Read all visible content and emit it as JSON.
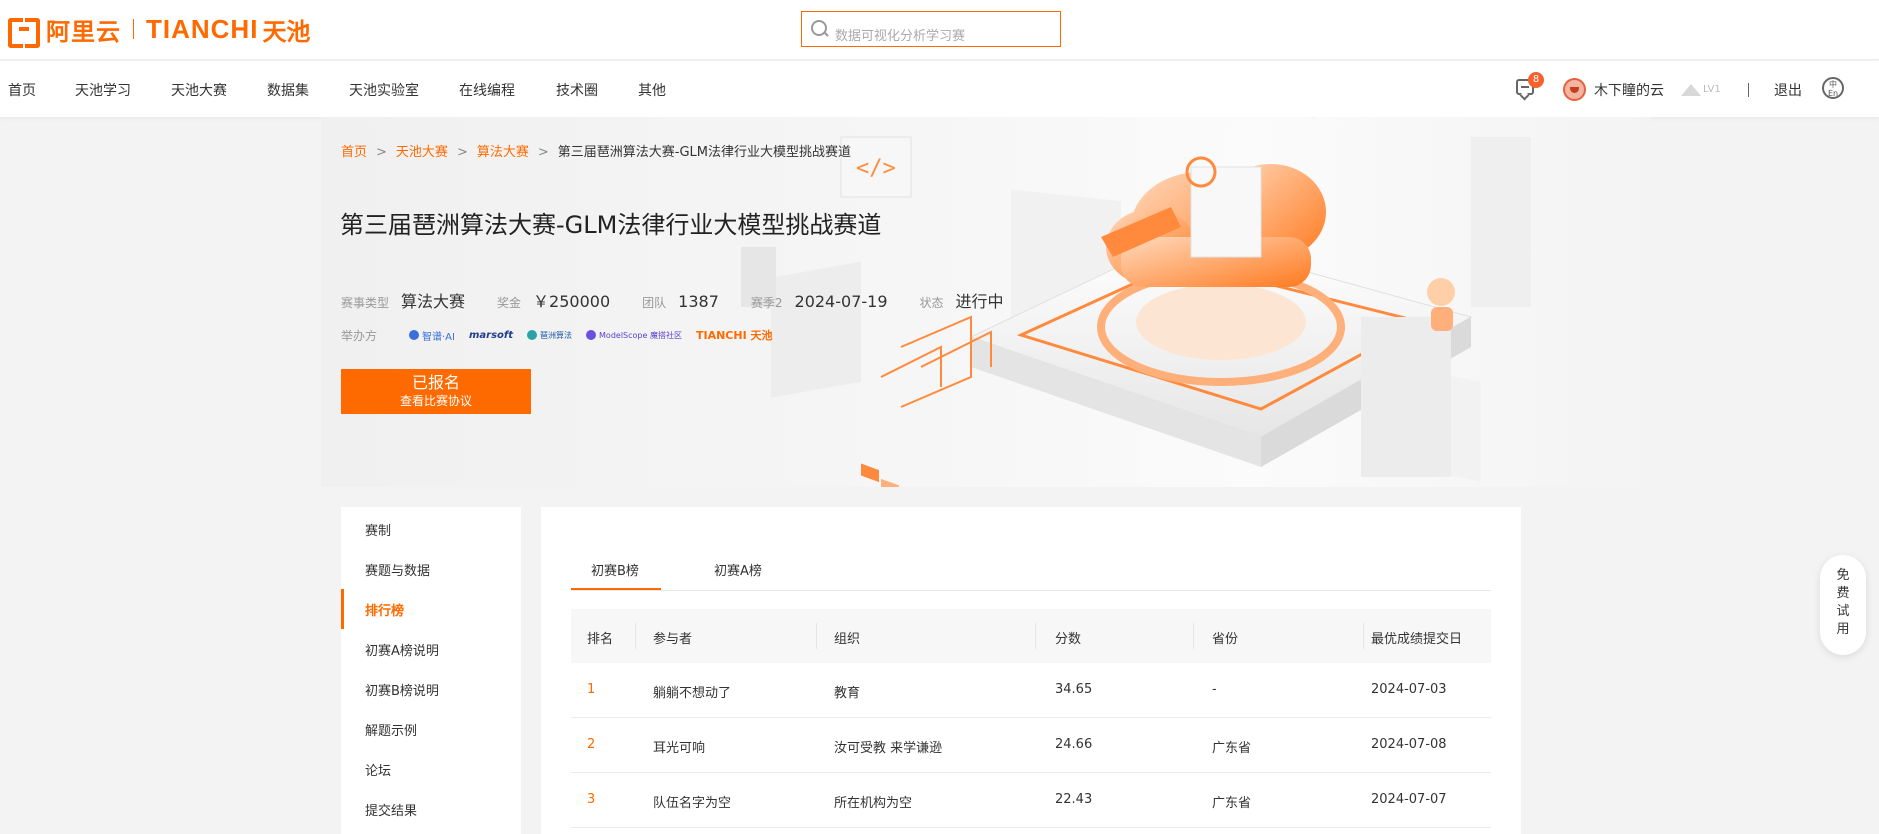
{
  "header": {
    "logo_cn": "阿里云",
    "logo_tianchi": "TIANCHI",
    "logo_tianchi_cn": "天池",
    "search_placeholder": "数据可视化分析学习赛"
  },
  "nav": {
    "items": [
      "首页",
      "天池学习",
      "天池大赛",
      "数据集",
      "天池实验室",
      "在线编程",
      "技术圈",
      "其他"
    ],
    "message_count": "8",
    "username": "木下瞳的云",
    "level": "LV1",
    "logout": "退出",
    "lang": "中 En"
  },
  "breadcrumb": {
    "items": [
      "首页",
      "天池大赛",
      "算法大赛"
    ],
    "separator": ">",
    "current": "第三届琶洲算法大赛-GLM法律行业大模型挑战赛道"
  },
  "competition": {
    "title": "第三届琶洲算法大赛-GLM法律行业大模型挑战赛道",
    "type_label": "赛事类型",
    "type_value": "算法大赛",
    "prize_label": "奖金",
    "prize_value": "￥250000",
    "teams_label": "团队",
    "teams_value": "1387",
    "season_label": "赛季2",
    "season_value": "2024-07-19",
    "status_label": "状态",
    "status_value": "进行中",
    "organizer_label": "举办方",
    "organizers": [
      "智谱·AI",
      "marsoft",
      "琶洲算法",
      "ModelScope 魔搭社区",
      "TIANCHI 天池"
    ],
    "cta_main": "已报名",
    "cta_sub": "查看比赛协议"
  },
  "sidebar": {
    "items": [
      "赛制",
      "赛题与数据",
      "排行榜",
      "初赛A榜说明",
      "初赛B榜说明",
      "解题示例",
      "论坛",
      "提交结果"
    ],
    "active_index": 2
  },
  "leaderboard": {
    "tabs": [
      "初赛B榜",
      "初赛A榜"
    ],
    "columns": [
      "排名",
      "参与者",
      "组织",
      "分数",
      "省份",
      "最优成绩提交日"
    ],
    "rows": [
      {
        "rank": "1",
        "participant": "躺躺不想动了",
        "org": "教育",
        "score": "34.65",
        "province": "-",
        "date": "2024-07-03"
      },
      {
        "rank": "2",
        "participant": "耳光可响",
        "org": "汝可受教 来学谦逊",
        "score": "24.66",
        "province": "广东省",
        "date": "2024-07-08"
      },
      {
        "rank": "3",
        "participant": "队伍名字为空",
        "org": "所在机构为空",
        "score": "22.43",
        "province": "广东省",
        "date": "2024-07-07"
      }
    ]
  },
  "float_trial": [
    "免",
    "费",
    "试",
    "用"
  ],
  "colors": {
    "accent": "#ff6a00",
    "badge": "#f5622d"
  }
}
